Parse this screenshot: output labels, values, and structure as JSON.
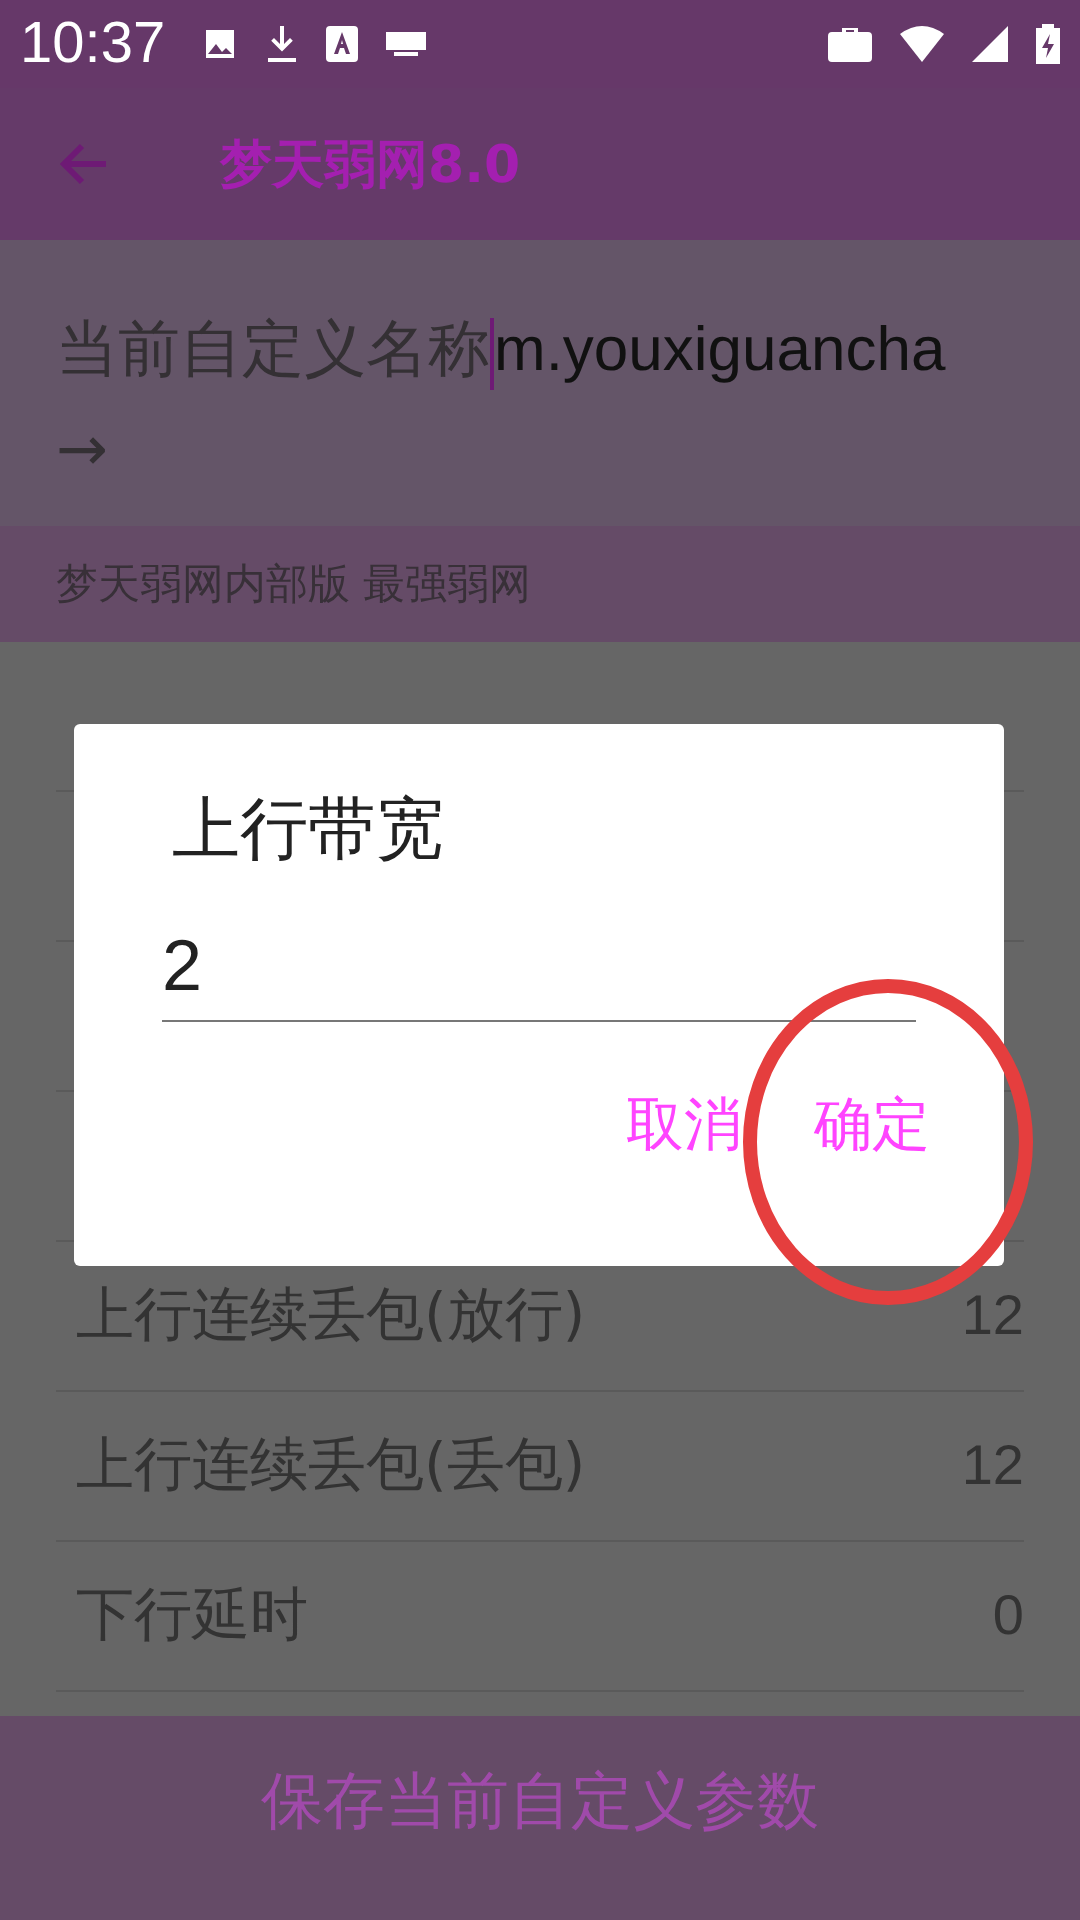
{
  "status_bar": {
    "time": "10:37"
  },
  "app_bar": {
    "title": "梦天弱网8.0"
  },
  "name_field": {
    "label": "当前自定义名称",
    "value": "m.youxiguancha",
    "suffix": "→"
  },
  "subtitle": "梦天弱网内部版  最强弱网",
  "settings": [
    {
      "kind": "covered"
    },
    {
      "kind": "covered"
    },
    {
      "kind": "covered"
    },
    {
      "kind": "covered"
    },
    {
      "kind": "setting",
      "label": "上行连续丢包(放行)",
      "value": "12"
    },
    {
      "kind": "setting",
      "label": "上行连续丢包(丢包)",
      "value": "12"
    },
    {
      "kind": "setting",
      "label": "下行延时",
      "value": "0"
    }
  ],
  "save_button": "保存当前自定义参数",
  "dialog": {
    "title": "上行带宽",
    "value": "2",
    "buttons": [
      "取消",
      "确定"
    ]
  },
  "highlight": {
    "kind": "ellipse"
  }
}
